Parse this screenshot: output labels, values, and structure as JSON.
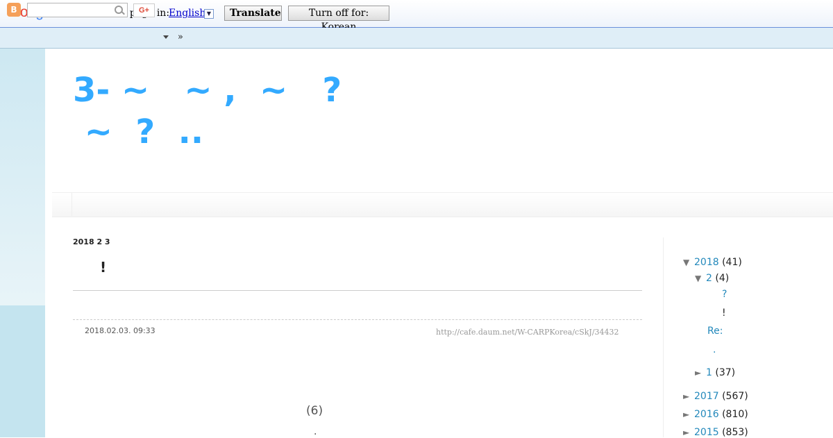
{
  "translate_bar": {
    "logo": "Google",
    "view_text": "View this page in:",
    "language": "English",
    "dropdown_glyph": "▼",
    "translate_label": "Translate",
    "turnoff_label": "Turn off for: Korean",
    "icons": [
      "lock-icon"
    ]
  },
  "navbar": {
    "blogger_glyph": "B",
    "search_placeholder": "",
    "gplus_label": "G+",
    "more_label": "»",
    "icons": [
      "blogger-icon",
      "search-icon",
      "caret-down-icon"
    ]
  },
  "blog": {
    "title_line1": "3- ~   ~ ,  ~   ?",
    "title_line2": " ~  ?  .."
  },
  "post": {
    "date_header": "2018 2 3",
    "title": "!",
    "timestamp": "2018.02.03. 09:33",
    "source_link": "http://cafe.daum.net/W-CARPKorea/cSkJ/34432",
    "comments": "(6)",
    "trailing": "."
  },
  "archive": {
    "toggle_open": "▼",
    "toggle_closed": "►",
    "years": [
      {
        "year": "2018",
        "count": "(41)",
        "expanded": true
      },
      {
        "year": "2017",
        "count": "(567)",
        "expanded": false
      },
      {
        "year": "2016",
        "count": "(810)",
        "expanded": false
      },
      {
        "year": "2015",
        "count": "(853)",
        "expanded": false
      }
    ],
    "months": [
      {
        "month": "2",
        "count": "(4)",
        "expanded": true
      },
      {
        "month": "1",
        "count": "(37)",
        "expanded": false
      }
    ],
    "posts": [
      "?",
      "!",
      "Re:",
      "."
    ]
  }
}
